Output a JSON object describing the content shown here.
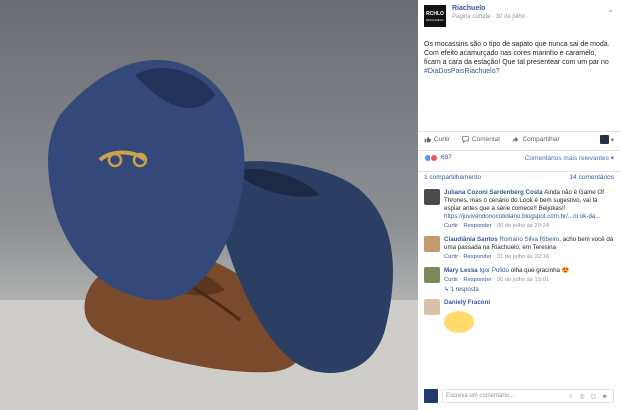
{
  "page": {
    "name": "Riachuelo",
    "meta": "Página curtida · 30 de julho ·",
    "logo_text": "RCHLO",
    "logo_sub": "RIACHUELO"
  },
  "post": {
    "text": "Os mocassins são o tipo de sapato que nunca sai de moda. Com efeito acamurçado nas cores marinho e caramelo, ficam a cara da estação! Que tal presentear com um par no ",
    "hashtag": "#DiaDosPaisRiachuelo?"
  },
  "actions": {
    "like": "Curtir",
    "comment": "Comentar",
    "share": "Compartilhar"
  },
  "reactions": {
    "count": "697",
    "sort": "Comentários mais relevantes ▾"
  },
  "shares": {
    "shares": "1 compartilhamento",
    "comments": "14 comentários"
  },
  "comments": [
    {
      "name": "Juliana Cozoni Sardenberg Costa",
      "text": " Ainda não é Game Of Thrones, mas o cenário do Look é bem sugestivo, vai lá espiar antes que a série comece!! Beijokas!!",
      "link": "https://juvivendonocotidiano.blogspot.com.br/.../o ok-da...",
      "like": "Curtir",
      "reply": "Responder",
      "time": " · 30 de julho às 20:24"
    },
    {
      "name": "Claudiânia Santos",
      "mention": "Romario Silva Ribeiro",
      "text": ", acho bem você dá uma passada na Riachuelo, em Teresina",
      "like": "Curtir",
      "reply": "Responder",
      "time": " · 31 de julho às 22:16"
    },
    {
      "name": "Mary Lessa",
      "mention": "Igor Pulido",
      "text": " olha que gracinha 😍",
      "like": "Curtir",
      "reply": "Responder",
      "time": " · 30 de julho às 15:01",
      "replies": "↳ 1 resposta"
    },
    {
      "name": "Daniely Fraconi",
      "text": "",
      "like": "",
      "reply": "",
      "time": ""
    }
  ],
  "input": {
    "placeholder": "Escreva um comentário...",
    "tools": "☺ ◎ ▢ ☻"
  },
  "colors": {
    "link": "#365899",
    "like_blue": "#5890ff",
    "love_red": "#f25268"
  }
}
